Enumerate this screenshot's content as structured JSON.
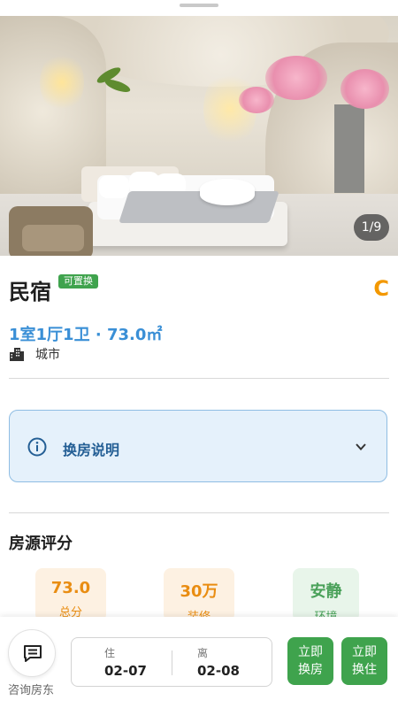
{
  "hero": {
    "image_alt": "cave-style bedroom photo",
    "counter": "1/9"
  },
  "listing": {
    "title": "民宿",
    "badge": "可置换",
    "grade": "C",
    "spec": "1室1厅1卫 · 73.0㎡",
    "location": "城市"
  },
  "info_box": {
    "label": "换房说明"
  },
  "rating": {
    "title": "房源评分",
    "items": [
      {
        "value": "73.0",
        "label": "总分",
        "tone": "orange"
      },
      {
        "value": "30万",
        "label": "装修",
        "tone": "orange"
      },
      {
        "value": "安静",
        "label": "环境",
        "tone": "green"
      }
    ]
  },
  "bottom_bar": {
    "consult_label": "咨询房东",
    "checkin_caption": "住",
    "checkin_date": "02-07",
    "checkout_caption": "离",
    "checkout_date": "02-08",
    "swap_button": [
      "立即",
      "换房"
    ],
    "stay_button": [
      "立即",
      "换住"
    ]
  },
  "colors": {
    "accent_green": "#3fa34d",
    "accent_blue": "#3a8fd6",
    "grade_orange": "#f39800"
  }
}
